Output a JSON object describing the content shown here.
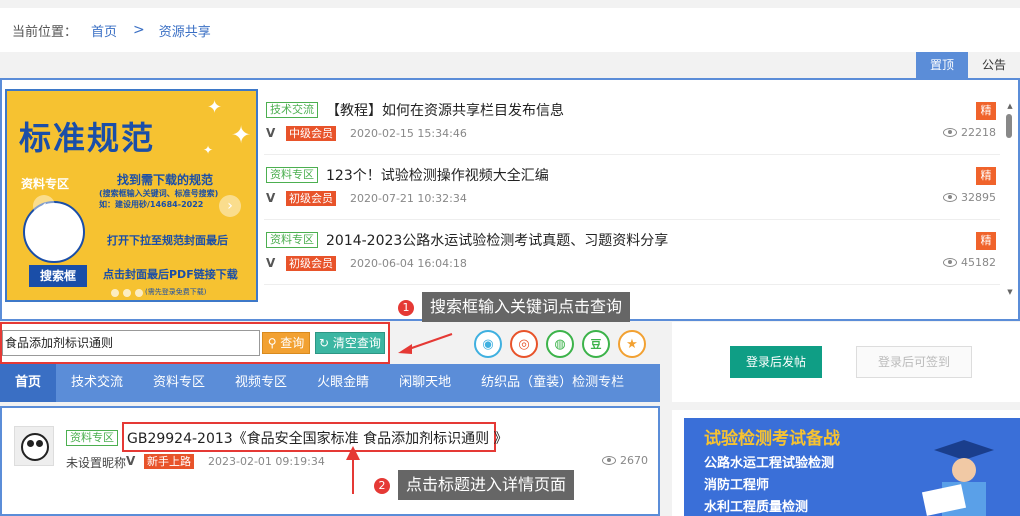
{
  "breadcrumb": {
    "label": "当前位置：",
    "home": "首页",
    "separator": ">",
    "current": "资源共享"
  },
  "top_tabs": [
    {
      "label": "置顶",
      "active": true
    },
    {
      "label": "公告",
      "active": false
    }
  ],
  "banner": {
    "title": "标准规范",
    "zone": "资料专区",
    "line1": "找到需下载的规范",
    "line2": "(搜索框输入关键词、标准号搜索)",
    "line2b": "如：建设用砂/14684-2022",
    "line3": "打开下拉至规范封面最后",
    "line4": "点击封面最后PDF链接下载",
    "line5": "(需先登录免费下载)",
    "search_label": "搜索框",
    "prev_glyph": "‹",
    "next_glyph": "›"
  },
  "featured": [
    {
      "tag": "技术交流",
      "title": "【教程】如何在资源共享栏目发布信息",
      "v": "V",
      "level": "中级会员",
      "date": "2020-02-15 15:34:46",
      "badge": "精",
      "views": "22218"
    },
    {
      "tag": "资料专区",
      "title": "123个！试验检测操作视频大全汇编",
      "v": "V",
      "level": "初级会员",
      "date": "2020-07-21 10:32:34",
      "badge": "精",
      "views": "32895"
    },
    {
      "tag": "资料专区",
      "title": "2014-2023公路水运试验检测考试真题、习题资料分享",
      "v": "V",
      "level": "初级会员",
      "date": "2020-06-04 16:04:18",
      "badge": "精",
      "views": "45182"
    }
  ],
  "callouts": {
    "one_num": "1",
    "one_text": "搜索框输入关键词点击查询",
    "two_num": "2",
    "two_text": "点击标题进入详情页面"
  },
  "search": {
    "value": "食品添加剂标识通则",
    "query_label": "查询",
    "clear_label": "清空查询"
  },
  "share_icons": [
    "qq-icon",
    "weibo-icon",
    "wechat-icon",
    "douban-icon",
    "qzone-icon"
  ],
  "share_glyphs": [
    "◉",
    "◎",
    "◍",
    "豆",
    "★"
  ],
  "right": {
    "post_label": "登录后发帖",
    "sign_label": "登录后可签到",
    "promo_title": "试验检测考试备战",
    "promo_1": "公路水运工程试验检测",
    "promo_2": "消防工程师",
    "promo_3": "水利工程质量检测"
  },
  "nav": [
    {
      "label": "首页",
      "active": true
    },
    {
      "label": "技术交流",
      "active": false
    },
    {
      "label": "资料专区",
      "active": false
    },
    {
      "label": "视频专区",
      "active": false
    },
    {
      "label": "火眼金睛",
      "active": false
    },
    {
      "label": "闲聊天地",
      "active": false
    },
    {
      "label": "纺织品（童装）检测专栏",
      "active": false
    }
  ],
  "result": {
    "tag": "资料专区",
    "title": "GB29924-2013《食品安全国家标准 食品添加剂标识通则 》",
    "user": "未设置昵称",
    "v": "V",
    "level": "新手上路",
    "date": "2023-02-01 09:19:34",
    "views": "2670"
  },
  "colors": {
    "accent": "#5b8dd8",
    "highlight": "#e53935",
    "tag_green": "#4caf50",
    "badge_orange": "#f0632b",
    "btn_teal": "#0f9e85"
  }
}
